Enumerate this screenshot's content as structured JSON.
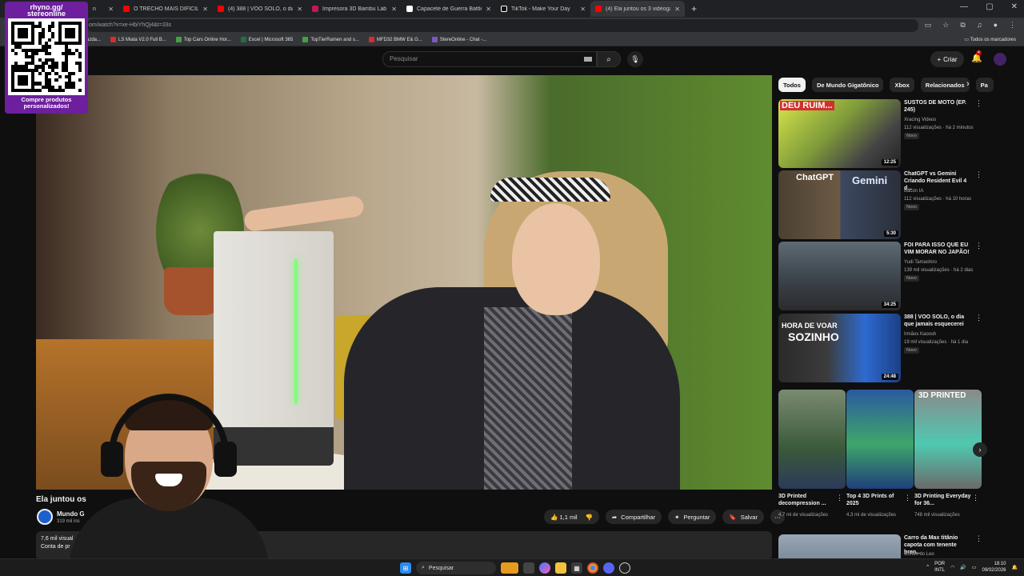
{
  "browser": {
    "tabs": [
      {
        "label": "n",
        "color": "#ff0000"
      },
      {
        "label": "O TRECHO MAIS DIFÍCIL! Tran",
        "color": "#ff0000"
      },
      {
        "label": "(4) 388 | VOO SOLO, o dia que",
        "color": "#ff0000"
      },
      {
        "label": "Impresora 3D Bambu Lab P2S",
        "color": "#c2185b"
      },
      {
        "label": "Capacete de Guerra Battle Cat",
        "color": "#ffffff"
      },
      {
        "label": "TikTok - Make Your Day",
        "color": "#111111"
      },
      {
        "label": "(4) Ela juntou os 3 videogame",
        "color": "#ff0000"
      }
    ],
    "url": "om/watch?v=xe-HbiYhQj4&t=33s",
    "bookmarks": [
      {
        "label": "azda...",
        "color": "#ff6f00"
      },
      {
        "label": "LS Miata V2.0 Full B...",
        "color": "#d32f2f"
      },
      {
        "label": "Top Cars Online Hor...",
        "color": "#43a047"
      },
      {
        "label": "Excel | Microsoft 365",
        "color": "#1e7145"
      },
      {
        "label": "TopTierRamen and s...",
        "color": "#43a047"
      },
      {
        "label": "MFD32 BMW E& G...",
        "color": "#d32f2f"
      },
      {
        "label": "StereOnline - Chat -...",
        "color": "#7e57c2"
      }
    ],
    "bookmarks_right": "Todos os marcadores"
  },
  "overlay": {
    "handle_line1": "rhyno.gg/",
    "handle_line2": "stereonline",
    "promo_line1": "Compre produtos",
    "promo_line2": "personalizados!"
  },
  "youtube": {
    "search_placeholder": "Pesquisar",
    "create_label": "Criar",
    "notifications_badge": "4",
    "video": {
      "title": "Ela juntou os",
      "channel_name": "Mundo G",
      "subscribers": "319 mil ins",
      "likes": "1,1 mil",
      "share_label": "Compartilhar",
      "ask_label": "Perguntar",
      "save_label": "Salvar",
      "desc_views": "7,6 mil visual",
      "desc_line2": "Conta de pr"
    },
    "chips": [
      "Todos",
      "De Mundo Gigatônico",
      "Xbox",
      "Relacionados",
      "Pa"
    ],
    "recommendations": [
      {
        "title": "SUSTOS DE MOTO (EP. 245)",
        "channel": "Xracing Videos",
        "views": "112 visualizações · há 2 minutos",
        "badge": "Novo",
        "duration": "12:25",
        "thumb_text": "DEU RUIM..."
      },
      {
        "title": "ChatGPT vs Gemini Criando Resident Evil 4 d...",
        "channel": "Bacon IA",
        "views": "112 visualizações · há 10 horas",
        "badge": "Novo",
        "duration": "5:30",
        "thumb_text": "ChatGPT",
        "thumb_text2": "Gemini"
      },
      {
        "title": "FOI PARA ISSO QUE EU VIM MORAR NO JAPÃO!",
        "channel": "Yudi Tamashiro",
        "views": "139 mil visualizações · há 2 dias",
        "badge": "Novo",
        "duration": "34:25"
      },
      {
        "title": "388 | VOO SOLO, o dia que jamais esquecerei",
        "channel": "Irmãos Kaoosh",
        "views": "19 mil visualizações · há 1 dia",
        "badge": "Novo",
        "duration": "24:48",
        "thumb_text": "HORA DE VOAR",
        "thumb_text2": "SOZINHO"
      }
    ],
    "shorts": [
      {
        "title": "3D Printed decompression ...",
        "views": "4,7 mi de visualizações"
      },
      {
        "title": "Top 4 3D Prints of 2025",
        "views": "4,3 mi de visualizações"
      },
      {
        "title": "3D Printing Everyday for 36...",
        "views": "748 mil visualizações",
        "thumb_text": "3D PRINTED"
      }
    ],
    "next_rec": {
      "title": "Carro da Max titânio capota com tenente bren...",
      "channel": "Cortes do Leo"
    }
  },
  "taskbar": {
    "search_label": "Pesquisar",
    "lang_line1": "POR",
    "lang_line2": "INTL",
    "time": "18:10",
    "date": "09/02/2026"
  }
}
